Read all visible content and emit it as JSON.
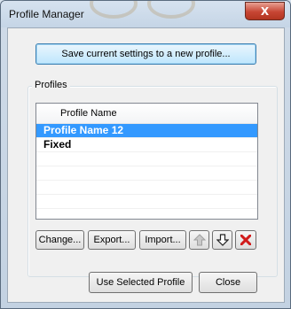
{
  "window": {
    "title": "Profile Manager",
    "close_symbol": "X"
  },
  "save_button_label": "Save current settings to a new profile...",
  "profiles_group": {
    "label": "Profiles",
    "column_header": "Profile Name",
    "items": [
      {
        "name": "Profile Name 12",
        "selected": true
      },
      {
        "name": "Fixed",
        "selected": false
      }
    ]
  },
  "actions": {
    "change": "Change...",
    "export": "Export...",
    "import": "Import..."
  },
  "icons": {
    "move_up": "arrow-up-icon",
    "move_down": "arrow-down-icon",
    "delete": "red-x-icon"
  },
  "footer": {
    "use_selected": "Use Selected Profile",
    "close": "Close"
  },
  "colors": {
    "selection": "#3399ff",
    "delete_red": "#d11b1b",
    "accent_border": "#3c7fb1"
  }
}
